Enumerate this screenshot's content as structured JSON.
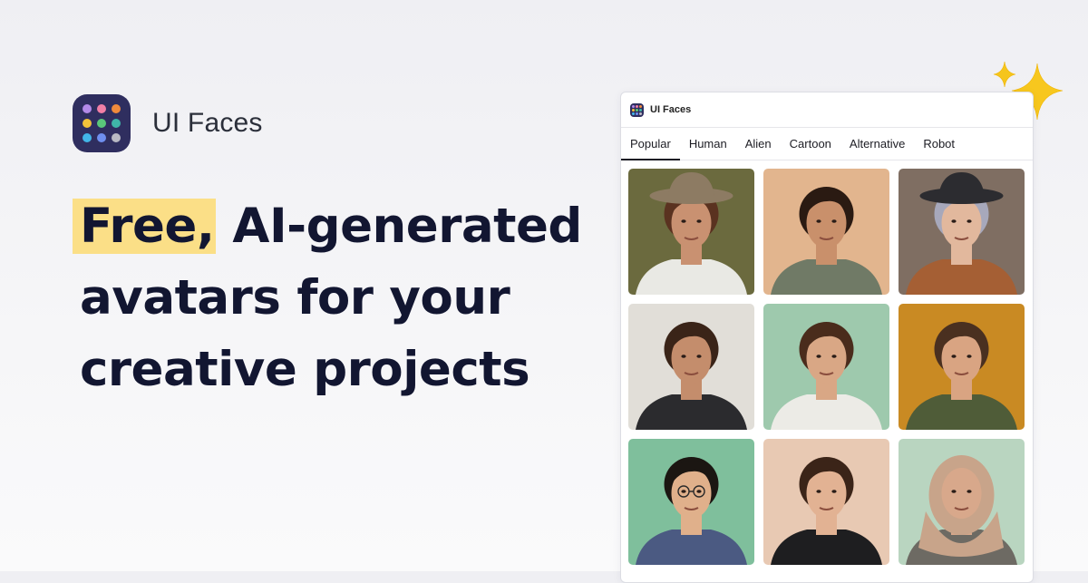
{
  "brand": {
    "name": "UI Faces",
    "logo_dots": [
      "#b38ae8",
      "#f17fa6",
      "#f08a3c",
      "#f2c23a",
      "#5ac87a",
      "#3fb6a8",
      "#42b6e8",
      "#6f8ff0",
      "#b9b9c4"
    ]
  },
  "headline": {
    "highlight": "Free,",
    "line1_rest": " AI-generated",
    "line2": "avatars for your",
    "line3": "creative projects",
    "highlight_color": "#fbdf87"
  },
  "window": {
    "title": "UI Faces",
    "tabs": [
      {
        "label": "Popular",
        "active": true
      },
      {
        "label": "Human",
        "active": false
      },
      {
        "label": "Alien",
        "active": false
      },
      {
        "label": "Cartoon",
        "active": false
      },
      {
        "label": "Alternative",
        "active": false
      },
      {
        "label": "Robot",
        "active": false
      }
    ],
    "avatars": [
      {
        "name": "avatar-woman-hat-bangs",
        "bg": "#6b6a3e",
        "skin": "#c99171",
        "hair": "#5a3220",
        "shirt": "#e9e9e4",
        "hat": "#8d7b63"
      },
      {
        "name": "avatar-man-curly-dark",
        "bg": "#e2b58e",
        "skin": "#c9906b",
        "hair": "#2a1a12",
        "shirt": "#707a66",
        "hat": ""
      },
      {
        "name": "avatar-woman-silver-hair-hat",
        "bg": "#7f6e62",
        "skin": "#e2b89d",
        "hair": "#a7a8bb",
        "shirt": "#a55f34",
        "hat": "#2c2c30"
      },
      {
        "name": "avatar-man-quiff-beard",
        "bg": "#e1ded8",
        "skin": "#c48d6c",
        "hair": "#3a2418",
        "shirt": "#2b2b2e",
        "hat": ""
      },
      {
        "name": "avatar-man-curly-hair",
        "bg": "#9ec9ad",
        "skin": "#d9a785",
        "hair": "#4a2c1c",
        "shirt": "#ecebe6",
        "hat": ""
      },
      {
        "name": "avatar-man-smiling-jacket",
        "bg": "#c98a23",
        "skin": "#d9a482",
        "hair": "#4a3020",
        "shirt": "#4f5c38",
        "hat": ""
      },
      {
        "name": "avatar-man-glasses-smiling",
        "bg": "#7fbf9c",
        "skin": "#e0b08b",
        "hair": "#1b1612",
        "shirt": "#4b5a82",
        "hat": ""
      },
      {
        "name": "avatar-man-black-hoodie",
        "bg": "#e8c9b3",
        "skin": "#e2b293",
        "hair": "#3b2418",
        "shirt": "#1e1e20",
        "hat": ""
      },
      {
        "name": "avatar-woman-hijab",
        "bg": "#b9d5c0",
        "skin": "#d8a88b",
        "hair": "#c8a48a",
        "shirt": "#6d6a63",
        "hat": ""
      }
    ]
  }
}
